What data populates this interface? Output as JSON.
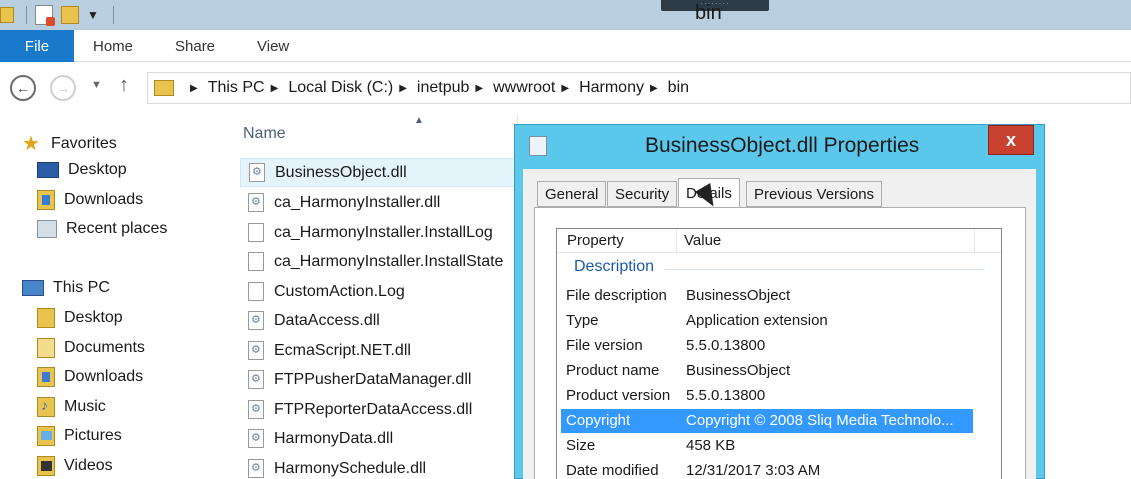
{
  "window": {
    "title": "bin"
  },
  "ribbon": {
    "file": "File",
    "tabs": [
      "Home",
      "Share",
      "View"
    ]
  },
  "address": {
    "crumbs": [
      "This PC",
      "Local Disk (C:)",
      "inetpub",
      "wwwroot",
      "Harmony",
      "bin"
    ]
  },
  "navpane": {
    "favorites": {
      "label": "Favorites",
      "items": [
        "Desktop",
        "Downloads",
        "Recent places"
      ]
    },
    "thispc": {
      "label": "This PC",
      "items": [
        "Desktop",
        "Documents",
        "Downloads",
        "Music",
        "Pictures",
        "Videos"
      ]
    }
  },
  "filelist": {
    "column_name": "Name",
    "files": [
      "BusinessObject.dll",
      "ca_HarmonyInstaller.dll",
      "ca_HarmonyInstaller.InstallLog",
      "ca_HarmonyInstaller.InstallState",
      "CustomAction.Log",
      "DataAccess.dll",
      "EcmaScript.NET.dll",
      "FTPPusherDataManager.dll",
      "FTPReporterDataAccess.dll",
      "HarmonyData.dll",
      "HarmonySchedule.dll"
    ]
  },
  "dialog": {
    "title": "BusinessObject.dll Properties",
    "close": "x",
    "tabs": [
      "General",
      "Security",
      "Details",
      "Previous Versions"
    ],
    "active_tab": "Details",
    "columns": [
      "Property",
      "Value"
    ],
    "group": "Description",
    "rows": [
      {
        "key": "File description",
        "value": "BusinessObject"
      },
      {
        "key": "Type",
        "value": "Application extension"
      },
      {
        "key": "File version",
        "value": "5.5.0.13800"
      },
      {
        "key": "Product name",
        "value": "BusinessObject"
      },
      {
        "key": "Product version",
        "value": "5.5.0.13800"
      },
      {
        "key": "Copyright",
        "value": "Copyright ©  2008 Sliq Media Technolo..."
      },
      {
        "key": "Size",
        "value": "458 KB"
      },
      {
        "key": "Date modified",
        "value": "12/31/2017 3:03 AM"
      }
    ],
    "selected_row": "Copyright"
  }
}
